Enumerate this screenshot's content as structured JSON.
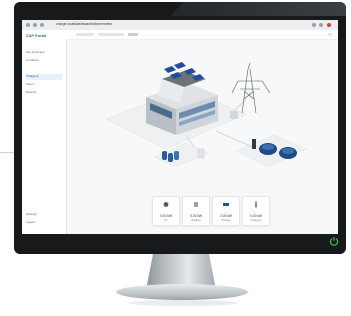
{
  "browser": {
    "url": "charge.local/dashboard/site/overview"
  },
  "sidebar": {
    "app_title": "ZAP Portal",
    "items": [
      {
        "label": "Site Overview"
      },
      {
        "label": "Locations"
      },
      {
        "label": "Chargers"
      },
      {
        "label": "Users"
      },
      {
        "label": "Reports"
      }
    ],
    "bottom_items": [
      {
        "label": "Settings"
      },
      {
        "label": "Logout"
      }
    ]
  },
  "cards": [
    {
      "icon": "solar-inverter-icon",
      "value": "0.00 kW",
      "label": "PV"
    },
    {
      "icon": "meter-icon",
      "value": "0.00 kW",
      "label": "Building"
    },
    {
      "icon": "battery-icon",
      "value": "0.00 kW",
      "label": "Storage"
    },
    {
      "icon": "ev-charger-icon",
      "value": "0.00 kW",
      "label": "Charging"
    }
  ],
  "colors": {
    "accent": "#1c6bb5",
    "brand": "#3a7d44",
    "power_icon": "#2ecc40"
  }
}
